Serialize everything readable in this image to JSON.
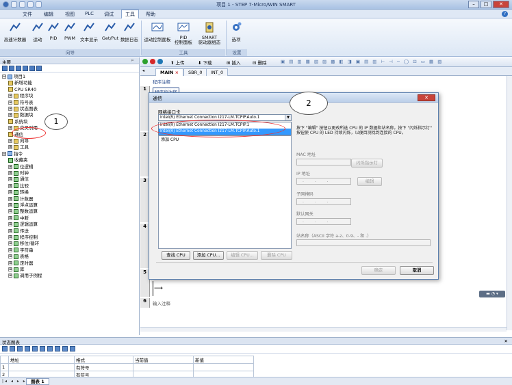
{
  "window": {
    "title": "项目 1 - STEP 7-Micro/WIN SMART",
    "minimize": "–",
    "maximize": "□",
    "close": "✕"
  },
  "menu": {
    "items": [
      "文件",
      "编辑",
      "视图",
      "PLC",
      "调试",
      "工具",
      "帮助"
    ],
    "active_index": 5,
    "help_icon": "?"
  },
  "ribbon": {
    "buttons": [
      "高速计数器",
      "运动",
      "PID",
      "PWM",
      "文本显示",
      "Get/Put",
      "数据日志",
      "运动控制面板",
      "PID\n控制面板",
      "SMART\n驱动器组态",
      "选项"
    ],
    "groups": [
      "向导",
      "工具",
      "设置"
    ]
  },
  "left_panel": {
    "header": "主要",
    "pin": "ᵖ",
    "tree": [
      {
        "label": "项目1",
        "pm": "⊟",
        "indent": 0
      },
      {
        "label": "新增功能",
        "indent": 1
      },
      {
        "label": "CPU SR40",
        "indent": 1
      },
      {
        "label": "程序块",
        "pm": "⊞",
        "indent": 1
      },
      {
        "label": "符号表",
        "pm": "⊞",
        "indent": 1
      },
      {
        "label": "状态图表",
        "pm": "⊞",
        "indent": 1
      },
      {
        "label": "数据块",
        "pm": "⊞",
        "indent": 1
      },
      {
        "label": "系统块",
        "indent": 1
      },
      {
        "label": "交叉引用",
        "pm": "⊞",
        "indent": 1
      },
      {
        "label": "通信",
        "indent": 1
      },
      {
        "label": "向导",
        "pm": "⊞",
        "indent": 1
      },
      {
        "label": "工具",
        "pm": "⊞",
        "indent": 1
      },
      {
        "label": "指令",
        "pm": "⊟",
        "indent": 0
      },
      {
        "label": "收藏夹",
        "indent": 1
      },
      {
        "label": "位逻辑",
        "pm": "⊞",
        "indent": 1
      },
      {
        "label": "时钟",
        "pm": "⊞",
        "indent": 1
      },
      {
        "label": "通信",
        "pm": "⊞",
        "indent": 1
      },
      {
        "label": "比较",
        "pm": "⊞",
        "indent": 1
      },
      {
        "label": "转换",
        "pm": "⊞",
        "indent": 1
      },
      {
        "label": "计数器",
        "pm": "⊞",
        "indent": 1
      },
      {
        "label": "浮点运算",
        "pm": "⊞",
        "indent": 1
      },
      {
        "label": "整数运算",
        "pm": "⊞",
        "indent": 1
      },
      {
        "label": "中断",
        "pm": "⊞",
        "indent": 1
      },
      {
        "label": "逻辑运算",
        "pm": "⊞",
        "indent": 1
      },
      {
        "label": "传送",
        "pm": "⊞",
        "indent": 1
      },
      {
        "label": "程序控制",
        "pm": "⊞",
        "indent": 1
      },
      {
        "label": "移位/循环",
        "pm": "⊞",
        "indent": 1
      },
      {
        "label": "字符串",
        "pm": "⊞",
        "indent": 1
      },
      {
        "label": "表格",
        "pm": "⊞",
        "indent": 1
      },
      {
        "label": "定时器",
        "pm": "⊞",
        "indent": 1
      },
      {
        "label": "库",
        "pm": "⊞",
        "indent": 1
      },
      {
        "label": "调用子例程",
        "pm": "⊞",
        "indent": 1
      }
    ]
  },
  "editor_toolbar": {
    "upload": "上传",
    "download": "下载",
    "insert": "插入",
    "delete": "删除"
  },
  "tabs": [
    "MAIN",
    "SBR_0",
    "INT_0"
  ],
  "tab_close": "×",
  "editor": {
    "program_comment": "程序注释",
    "network_comment": "程序段注释",
    "networks": [
      "1",
      "2",
      "3",
      "4",
      "5",
      "6"
    ],
    "network6_label": "输入注释",
    "network_arrow": "⟶"
  },
  "dialog": {
    "title": "通信",
    "close": "✕",
    "netcard_label": "网络接口卡",
    "netcard_value": "Intel(R) Ethernet Connection I217-LM.TCPIP.Auto.1",
    "netcard_options": [
      "Intel(R) Ethernet Connection I217-LM.TCPIP.1",
      "Intel(R) Ethernet Connection I217-LM.TCPIP.Auto.1"
    ],
    "dd_arrow": "▼",
    "cpu_list_item": "添加 CPU",
    "info": "按下 \"编辑\" 按钮以更改所选 CPU 的 IP 数据和站名称。按下 \"闪烁指示灯\" 按钮使 CPU 的 LED 持续闪烁，以便目测找到连接的 CPU。",
    "mac_label": "MAC 地址",
    "blink_button": "闪烁指示灯",
    "ip_label": "IP 地址",
    "edit_button": "编辑",
    "subnet_label": "子网掩码",
    "gateway_label": "默认网关",
    "station_label": "站名称（ASCII 字符 a-z、0-9、- 和 .）",
    "ip_placeholder": ". . .",
    "find_cpu": "查找 CPU",
    "add_cpu": "添加 CPU...",
    "edit_cpu": "编辑 CPU...",
    "delete_cpu": "删除 CPU",
    "ok": "确定",
    "cancel": "取消"
  },
  "annotations": {
    "callout1": "1",
    "callout2": "2"
  },
  "status_chart": {
    "header": "状态图表",
    "columns": [
      "",
      "地址",
      "格式",
      "当前值",
      "新值"
    ],
    "rows": [
      [
        "1",
        "",
        "有符号",
        "",
        ""
      ],
      [
        "2",
        "",
        "有符号",
        "",
        ""
      ]
    ],
    "sheet_tab": "图表 1",
    "nav": "|◂ ◂ ▸ ▸|"
  },
  "colors": {
    "accent": "#3399ff",
    "annotation": "#e33333",
    "close_red": "#c8443a"
  }
}
